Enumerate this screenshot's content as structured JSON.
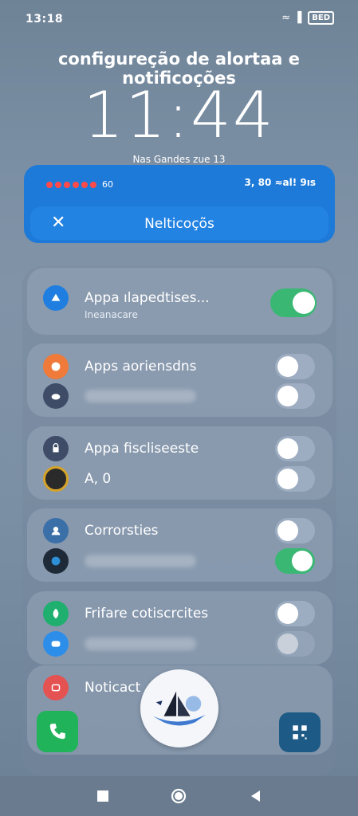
{
  "status_bar": {
    "time": "13:18",
    "icons_text": "≈ ▐",
    "battery": "BED"
  },
  "heading": "configureção de alortaa e notificoções",
  "lock": {
    "time": "11:44",
    "date": "Nas Gandes zue 13"
  },
  "blue_panel": {
    "dots_label": "60",
    "status_text": "3, 80 ≈al! 9ıs",
    "title": "Nelticoçõs"
  },
  "cards": [
    {
      "rows": [
        {
          "icon": "app-store-icon",
          "label": "Appa ılapedtises...",
          "sub": "Ineanacare",
          "toggle": "on"
        }
      ]
    },
    {
      "rows": [
        {
          "icon": "paint-icon",
          "label": "Apps aoriensdns",
          "toggle": "off"
        },
        {
          "icon": "cloud-icon",
          "label": "",
          "toggle": "off"
        }
      ]
    },
    {
      "rows": [
        {
          "icon": "lock-icon",
          "label": "Appa fiscliseeste",
          "toggle": "off"
        },
        {
          "icon": "ring-icon",
          "label": "A, 0",
          "toggle": "off"
        }
      ]
    },
    {
      "rows": [
        {
          "icon": "contact-icon",
          "label": "Corrorsties",
          "toggle": "off"
        },
        {
          "icon": "globe-icon",
          "label": "",
          "toggle": "on"
        }
      ]
    },
    {
      "rows": [
        {
          "icon": "leaf-icon",
          "label": "Frifare cotiscrcites",
          "toggle": "off"
        },
        {
          "icon": "chat-icon",
          "label": "",
          "toggle": "off-faded"
        }
      ]
    },
    {
      "rows": [
        {
          "icon": "smile-icon",
          "label": "Noticact"
        }
      ]
    }
  ],
  "colors": {
    "accent": "#1e7ad8",
    "toggle_on": "#3bb774",
    "phone": "#21b35a"
  }
}
